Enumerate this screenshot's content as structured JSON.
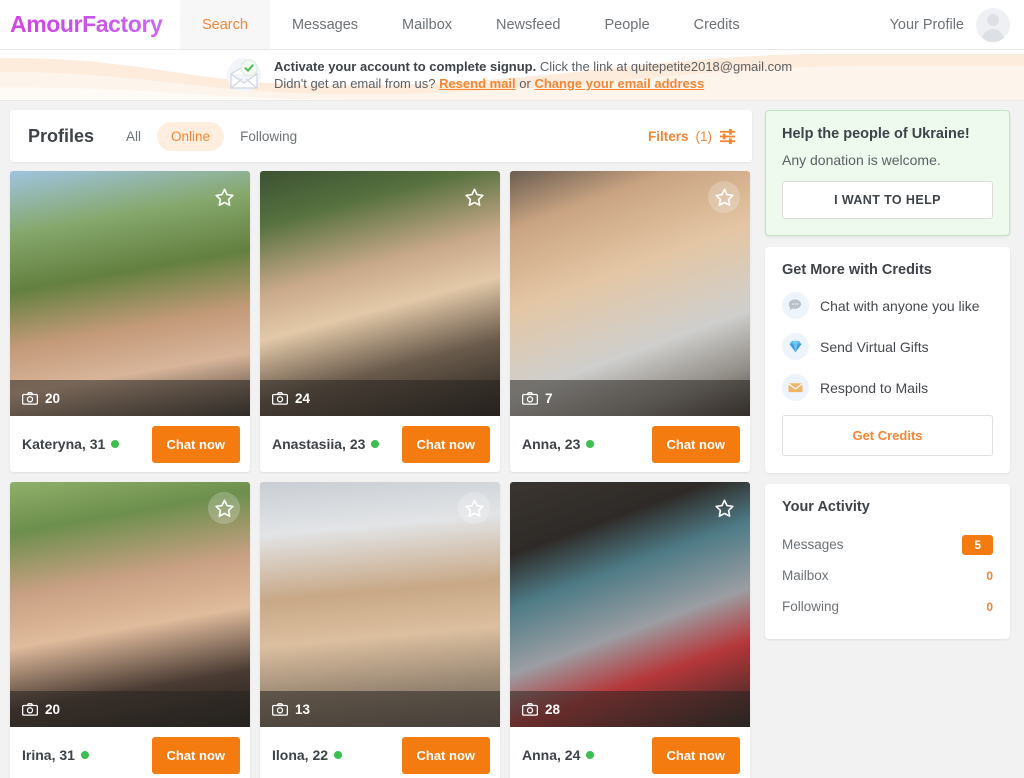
{
  "header": {
    "logo": "AmourFactory",
    "nav": [
      {
        "label": "Search",
        "name": "nav-search",
        "active": true
      },
      {
        "label": "Messages",
        "name": "nav-messages",
        "active": false
      },
      {
        "label": "Mailbox",
        "name": "nav-mailbox",
        "active": false
      },
      {
        "label": "Newsfeed",
        "name": "nav-newsfeed",
        "active": false
      },
      {
        "label": "People",
        "name": "nav-people",
        "active": false
      },
      {
        "label": "Credits",
        "name": "nav-credits",
        "active": false
      }
    ],
    "profile_label": "Your Profile",
    "avatar_icon": "user-avatar-placeholder-icon"
  },
  "banner": {
    "icon": "envelope-check-icon",
    "line1_bold": "Activate your account to complete signup.",
    "line1_rest": " Click the link at quitepetite2018@gmail.com",
    "line2_prefix": "Didn't get an email from us? ",
    "line2_link1": "Resend mail",
    "line2_mid": " or ",
    "line2_link2": "Change your email address"
  },
  "profiles": {
    "title": "Profiles",
    "tabs": [
      {
        "label": "All",
        "name": "tab-all",
        "active": false
      },
      {
        "label": "Online",
        "name": "tab-online",
        "active": true
      },
      {
        "label": "Following",
        "name": "tab-following",
        "active": false
      }
    ],
    "filters_label": "Filters",
    "filters_count": "(1)",
    "filters_icon": "sliders-icon"
  },
  "cards": [
    {
      "name": "Kateryna, 31",
      "photo_count": "20",
      "online": true,
      "chat_label": "Chat now",
      "starred": false,
      "star_disc": false,
      "photo": "linear-gradient(170deg,#9fc4e0 0%,#86a86d 22%,#63803f 42%,#c49a79 62%,#d8b59a 78%,#3a352f 100%)"
    },
    {
      "name": "Anastasiia, 23",
      "photo_count": "24",
      "online": true,
      "chat_label": "Chat now",
      "starred": false,
      "star_disc": false,
      "photo": "linear-gradient(165deg,#3c5232 0%,#57713f 18%,#c9a98a 40%,#e3c9a8 55%,#6a5b4c 75%,#241f1b 100%)"
    },
    {
      "name": "Anna, 23",
      "photo_count": "7",
      "online": true,
      "chat_label": "Chat now",
      "starred": false,
      "star_disc": true,
      "photo": "linear-gradient(160deg,#6b5d50 0%,#caa482 18%,#e4c6a4 42%,#cfcfcd 68%,#8f8a84 86%,#413a33 100%)"
    },
    {
      "name": "Irina, 31",
      "photo_count": "20",
      "online": true,
      "chat_label": "Chat now",
      "starred": false,
      "star_disc": true,
      "photo": "linear-gradient(170deg,#8fb06a 0%,#6d8f4d 18%,#c9a083 40%,#e0bb9c 58%,#4a3b33 80%,#22201d 100%)"
    },
    {
      "name": "Ilona, 22",
      "photo_count": "13",
      "online": true,
      "chat_label": "Chat now",
      "starred": false,
      "star_disc": true,
      "photo": "linear-gradient(175deg,#c9ced4 0%,#e2e4e6 20%,#c8a886 45%,#dcbf9f 62%,#9a8874 82%,#6e6259 100%)"
    },
    {
      "name": "Anna, 24",
      "photo_count": "28",
      "online": true,
      "chat_label": "Chat now",
      "starred": false,
      "star_disc": false,
      "photo": "linear-gradient(160deg,#3a3530 0%,#2e2a27 22%,#4e7b86 38%,#9b9ea3 58%,#b5373a 74%,#2a2724 100%)"
    }
  ],
  "sidebar": {
    "ukraine": {
      "title": "Help the people of Ukraine!",
      "subtitle": "Any donation is welcome.",
      "button": "I WANT TO HELP"
    },
    "credits": {
      "title": "Get More with Credits",
      "perks": [
        {
          "label": "Chat with anyone you like",
          "icon": "chat-bubble-icon"
        },
        {
          "label": "Send Virtual Gifts",
          "icon": "diamond-icon"
        },
        {
          "label": "Respond to Mails",
          "icon": "mail-envelope-icon"
        }
      ],
      "button": "Get Credits"
    },
    "activity": {
      "title": "Your Activity",
      "rows": [
        {
          "label": "Messages",
          "value": "5",
          "badge": true
        },
        {
          "label": "Mailbox",
          "value": "0",
          "badge": false
        },
        {
          "label": "Following",
          "value": "0",
          "badge": false
        }
      ]
    }
  },
  "colors": {
    "accent_orange": "#f58634",
    "button_orange": "#f47b10",
    "logo_magenta": "#d742e8",
    "online_green": "#3bbf4e",
    "ukraine_green_bg": "#effaef"
  }
}
